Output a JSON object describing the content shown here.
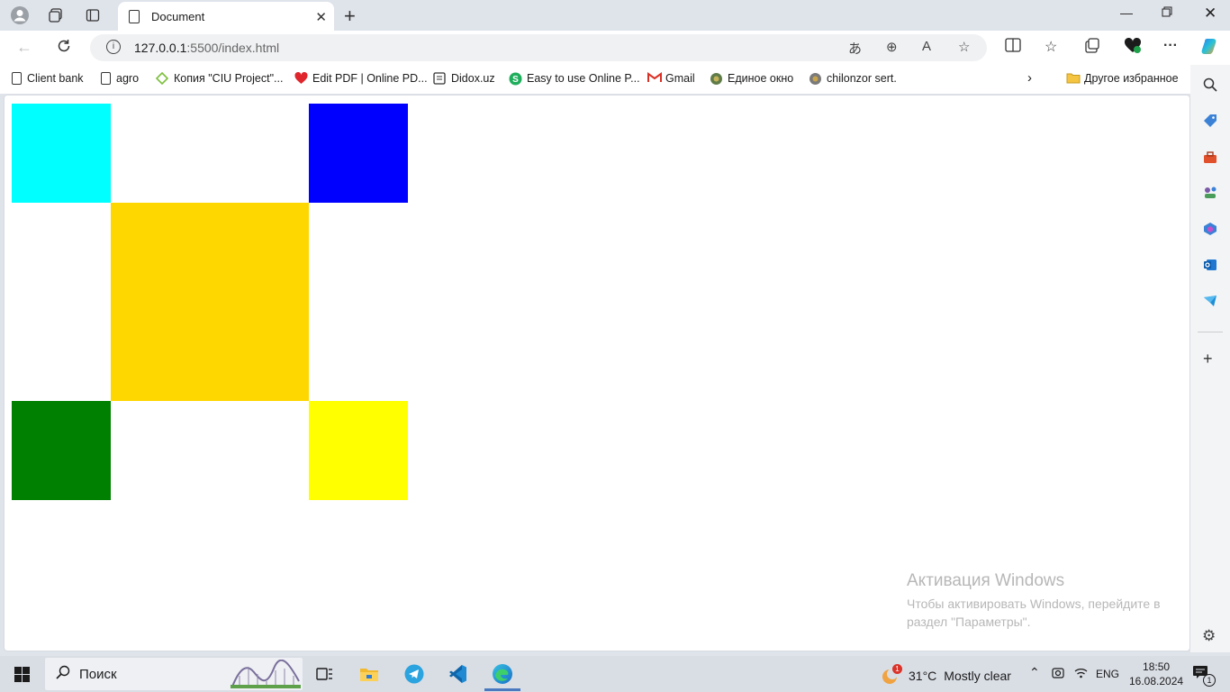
{
  "browser": {
    "tab": {
      "title": "Document"
    },
    "address": {
      "host": "127.0.0.1",
      "rest": ":5500/index.html"
    }
  },
  "bookmarks": [
    {
      "label": "Client bank"
    },
    {
      "label": "agro"
    },
    {
      "label": "Копия \"CIU Project\"..."
    },
    {
      "label": "Edit PDF | Online PD..."
    },
    {
      "label": "Didox.uz"
    },
    {
      "label": "Easy to use Online P..."
    },
    {
      "label": "Gmail"
    },
    {
      "label": "Единое окно"
    },
    {
      "label": "chilonzor sert."
    }
  ],
  "other_favorites": "Другое избранное",
  "page": {
    "squares": [
      {
        "color": "#00ffff"
      },
      {
        "color": "#0000ff"
      },
      {
        "color": "#ffd700"
      },
      {
        "color": "#008000"
      },
      {
        "color": "#ffff00"
      }
    ]
  },
  "activation": {
    "heading": "Активация Windows",
    "line1": "Чтобы активировать Windows, перейдите в",
    "line2": "раздел \"Параметры\"."
  },
  "taskbar": {
    "search_label": "Поиск",
    "weather": {
      "temp": "31°C",
      "condition": "Mostly clear",
      "badge": "1"
    },
    "language": "ENG",
    "time": "18:50",
    "date": "16.08.2024",
    "notifications": "1"
  }
}
